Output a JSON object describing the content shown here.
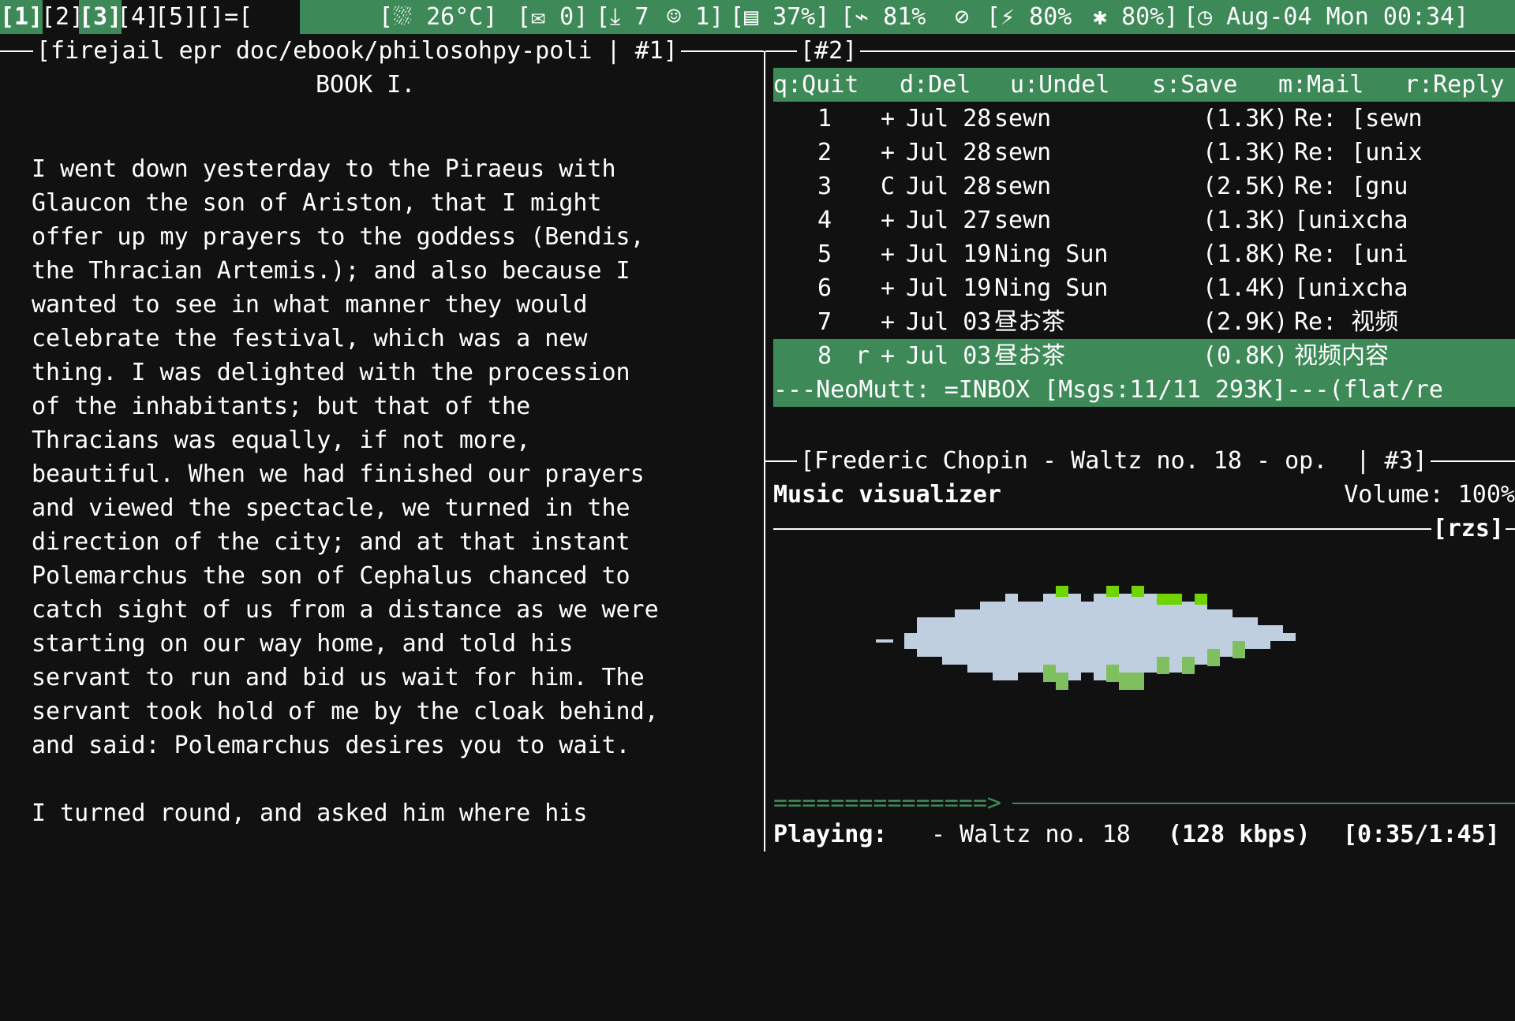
{
  "topbar": {
    "workspaces": [
      {
        "label": "[1]",
        "active": true
      },
      {
        "label": "[2]",
        "active": false
      },
      {
        "label": "[3]",
        "active": true
      },
      {
        "label": "[4]",
        "active": false
      },
      {
        "label": "[5]",
        "active": false
      },
      {
        "label": "[]=[",
        "active": false
      }
    ],
    "weather": "[⛆ 26°C]",
    "mail": "[✉ 0]",
    "downloads": "[⤓ 7",
    "users": "☺ 1]",
    "disk": "[▤ 37%]",
    "wifi": "[⌁ 81%",
    "mute": "⊘",
    "power": "[⚡ 80%",
    "bluetooth": "✱ 80%]",
    "clock": "[◷ Aug-04 Mon 00:34]"
  },
  "left_pane": {
    "title": "[firejail epr doc/ebook/philosohpy-poli | #1]",
    "heading": "BOOK I.",
    "lines": [
      "I went down yesterday to the Piraeus with",
      "Glaucon the son of Ariston, that I might",
      "offer up my prayers to the goddess (Bendis,",
      "the Thracian Artemis.); and also because I",
      "wanted to see in what manner they would",
      "celebrate the festival, which was a new",
      "thing. I was delighted with the procession",
      "of the inhabitants; but that of the",
      "Thracians was equally, if not more,",
      "beautiful. When we had finished our prayers",
      "and viewed the spectacle, we turned in the",
      "direction of the city; and at that instant",
      "Polemarchus the son of Cephalus chanced to",
      "catch sight of us from a distance as we were",
      "starting on our way home, and told his",
      "servant to run and bid us wait for him. The",
      "servant took hold of me by the cloak behind,",
      "and said: Polemarchus desires you to wait.",
      "",
      "I turned round, and asked him where his"
    ]
  },
  "mail_pane": {
    "title": "[#2]",
    "help": [
      {
        "key": "q:Quit"
      },
      {
        "key": "d:Del"
      },
      {
        "key": "u:Undel"
      },
      {
        "key": "s:Save"
      },
      {
        "key": "m:Mail"
      },
      {
        "key": "r:Reply"
      }
    ],
    "messages": [
      {
        "num": "1",
        "flag": "",
        "status": "+",
        "date": "Jul 28",
        "from": "sewn",
        "size": "(1.3K)",
        "subject": "Re: [sewn"
      },
      {
        "num": "2",
        "flag": "",
        "status": "+",
        "date": "Jul 28",
        "from": "sewn",
        "size": "(1.3K)",
        "subject": "Re: [unix"
      },
      {
        "num": "3",
        "flag": "",
        "status": "C",
        "date": "Jul 28",
        "from": "sewn",
        "size": "(2.5K)",
        "subject": "Re: [gnu"
      },
      {
        "num": "4",
        "flag": "",
        "status": "+",
        "date": "Jul 27",
        "from": "sewn",
        "size": "(1.3K)",
        "subject": "[unixcha"
      },
      {
        "num": "5",
        "flag": "",
        "status": "+",
        "date": "Jul 19",
        "from": "Ning Sun",
        "size": "(1.8K)",
        "subject": "Re: [uni"
      },
      {
        "num": "6",
        "flag": "",
        "status": "+",
        "date": "Jul 19",
        "from": "Ning Sun",
        "size": "(1.4K)",
        "subject": "[unixcha"
      },
      {
        "num": "7",
        "flag": "",
        "status": "+",
        "date": "Jul 03",
        "from": "昼お茶",
        "size": "(2.9K)",
        "subject": "Re: 视频"
      },
      {
        "num": "8",
        "flag": "r",
        "status": "+",
        "date": "Jul 03",
        "from": "昼お茶",
        "size": "(0.8K)",
        "subject": "视频内容"
      }
    ],
    "selected_index": 7,
    "statusbar": "---NeoMutt: =INBOX [Msgs:11/11 293K]---(flat/re"
  },
  "music_pane": {
    "title": "[Frederic Chopin - Waltz no. 18 - op.  | #3]",
    "viz_title": "Music visualizer",
    "volume": "Volume: 100%",
    "host_tag": "[rzs]",
    "progress_text": "===============>",
    "progress_fraction": 0.333,
    "playing_label": "Playing:",
    "playing_track": "- Waltz no. 18",
    "bitrate": "(128 kbps)",
    "time": "[0:35/1:45]",
    "colors": {
      "viz_body": "#c0cfe0",
      "viz_peak": "#6fd400",
      "viz_low": "#7fbf5f",
      "accent": "#3d8a58"
    }
  }
}
